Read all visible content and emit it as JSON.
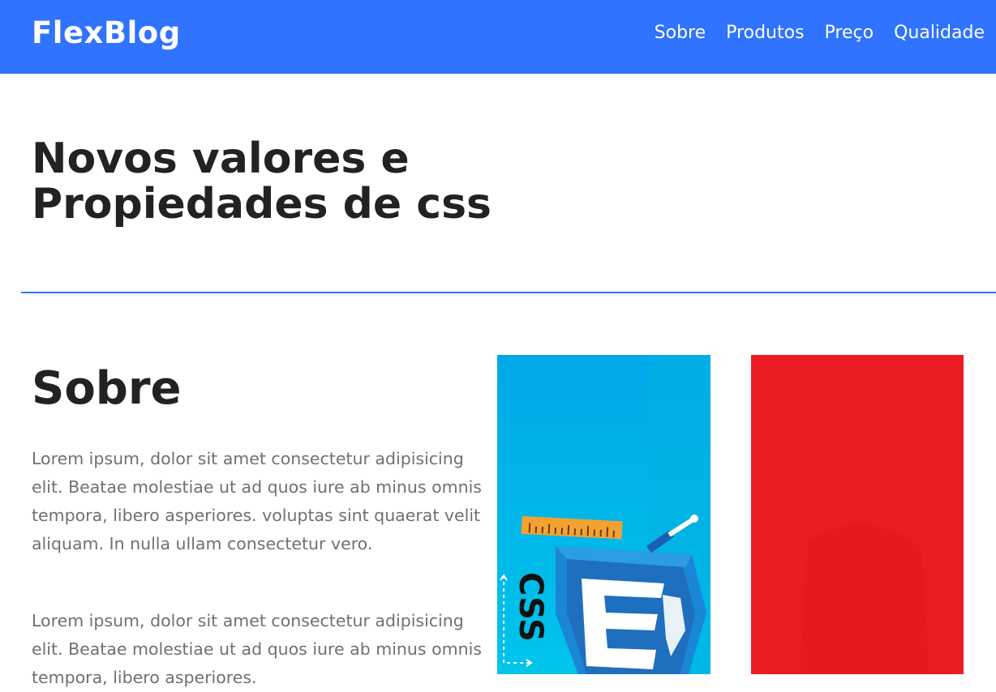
{
  "header": {
    "logo": "FlexBlog",
    "nav": [
      "Sobre",
      "Produtos",
      "Preço",
      "Qualidade"
    ]
  },
  "hero": {
    "title": "Novos valores e Propiedades de css"
  },
  "about": {
    "title": "Sobre",
    "paragraphs": [
      "Lorem ipsum, dolor sit amet consectetur adipisicing elit. Beatae molestiae ut ad quos iure ab minus omnis tempora, libero asperiores. voluptas sint quaerat velit aliquam. In nulla ullam consectetur vero.",
      "Lorem ipsum, dolor sit amet consectetur adipisicing elit. Beatae molestiae ut ad quos iure ab minus omnis tempora, libero asperiores."
    ],
    "css_image_text": "CSS"
  },
  "colors": {
    "header": "#2f73fe",
    "title": "#222222",
    "paragraph": "#707070",
    "css_image_bg": "#00b3e6",
    "red_image_bg": "#ec1c24"
  }
}
